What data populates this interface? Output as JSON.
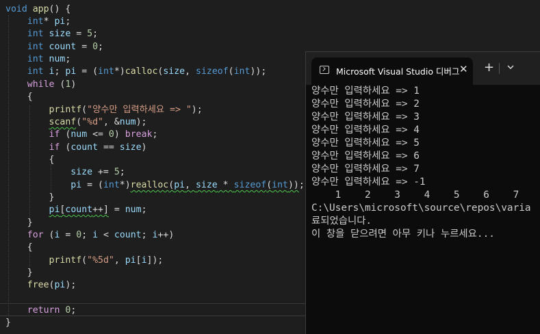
{
  "editor": {
    "lines": [
      "void app() {",
      "    int* pi;",
      "    int size = 5;",
      "    int count = 0;",
      "    int num;",
      "    int i; pi = (int*)calloc(size, sizeof(int));",
      "    while (1)",
      "    {",
      "        printf(\"양수만 입력하세요 => \");",
      "        scanf(\"%d\", &num);",
      "        if (num <= 0) break;",
      "        if (count == size)",
      "        {",
      "            size += 5;",
      "            pi = (int*)realloc(pi, size * sizeof(int));",
      "        }",
      "        pi[count++] = num;",
      "    }",
      "    for (i = 0; i < count; i++)",
      "    {",
      "        printf(\"%5d\", pi[i]);",
      "    }",
      "    free(pi);",
      "",
      "    return 0;",
      "}"
    ]
  },
  "terminal": {
    "tab_title": "Microsoft Visual Studio 디버그",
    "close_label": "✕",
    "new_tab_label": "+",
    "lines": [
      "양수만 입력하세요 => 1",
      "양수만 입력하세요 => 2",
      "양수만 입력하세요 => 3",
      "양수만 입력하세요 => 4",
      "양수만 입력하세요 => 5",
      "양수만 입력하세요 => 6",
      "양수만 입력하세요 => 7",
      "양수만 입력하세요 => -1",
      "    1    2    3    4    5    6    7",
      "C:\\Users\\microsoft\\source\\repos\\varia",
      "료되었습니다.",
      "이 창을 닫으려면 아무 키나 누르세요..."
    ]
  },
  "icons": {
    "tab_icon": "console-app-icon",
    "close": "close-icon",
    "new_tab": "plus-icon",
    "dropdown": "chevron-down-icon"
  },
  "colors": {
    "editor_bg": "#1e1e1e",
    "terminal_bg": "#0c0c0c",
    "keyword": "#569cd6",
    "control_keyword": "#d8a0df",
    "function": "#dcdcaa",
    "number": "#b5cea8",
    "string": "#d69d85",
    "variable": "#9cdcfe"
  }
}
